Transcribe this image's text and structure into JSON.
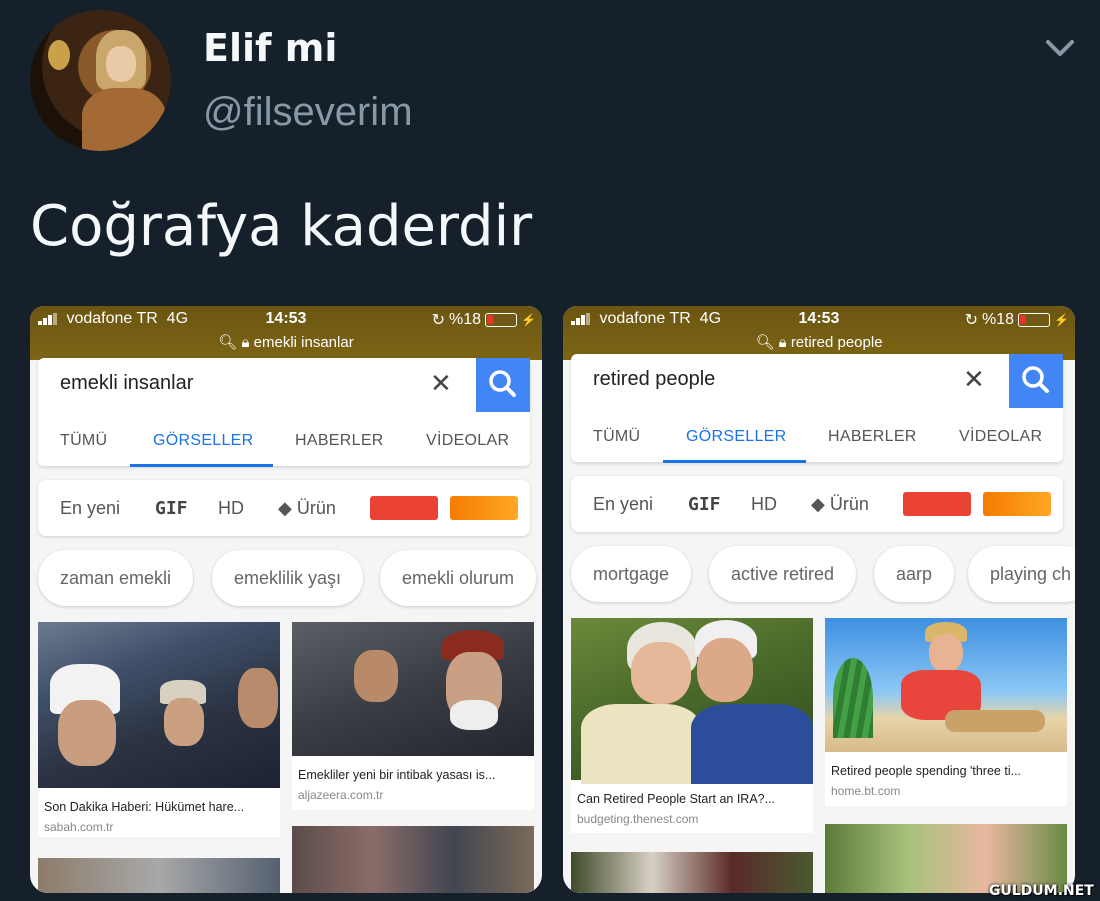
{
  "tweet": {
    "name": "Elif mi",
    "handle": "@filseverim",
    "text": "Coğrafya kaderdir"
  },
  "phones": [
    {
      "status": {
        "carrier": "vodafone TR",
        "network": "4G",
        "time": "14:53",
        "battery": "%18",
        "url": "emekli insanlar"
      },
      "query": "emekli insanlar",
      "tabs": [
        "TÜMÜ",
        "GÖRSELLER",
        "HABERLER",
        "VİDEOLAR"
      ],
      "active_tab": "GÖRSELLER",
      "filters": {
        "newest": "En yeni",
        "gif": "GIF",
        "hd": "HD",
        "product": "Ürün"
      },
      "colors": [
        "#ea4335",
        "#fb8c00"
      ],
      "chips": [
        "zaman emekli",
        "emeklilik yaşı",
        "emekli olurum"
      ],
      "results": [
        {
          "caption": "Son Dakika Haberi: Hükümet hare...",
          "source": "sabah.com.tr"
        },
        {
          "caption": "Emekliler yeni bir intibak yasası is...",
          "source": "aljazeera.com.tr"
        }
      ]
    },
    {
      "status": {
        "carrier": "vodafone TR",
        "network": "4G",
        "time": "14:53",
        "battery": "%18",
        "url": "retired people"
      },
      "query": "retired people",
      "tabs": [
        "TÜMÜ",
        "GÖRSELLER",
        "HABERLER",
        "VİDEOLAR"
      ],
      "active_tab": "GÖRSELLER",
      "filters": {
        "newest": "En yeni",
        "gif": "GIF",
        "hd": "HD",
        "product": "Ürün"
      },
      "colors": [
        "#ea4335",
        "#fb8c00"
      ],
      "chips": [
        "mortgage",
        "active retired",
        "aarp",
        "playing ch"
      ],
      "results": [
        {
          "caption": "Can Retired People Start an IRA?...",
          "source": "budgeting.thenest.com"
        },
        {
          "caption": "Retired people spending 'three ti...",
          "source": "home.bt.com"
        }
      ]
    }
  ],
  "watermark": "GULDUM.NET"
}
